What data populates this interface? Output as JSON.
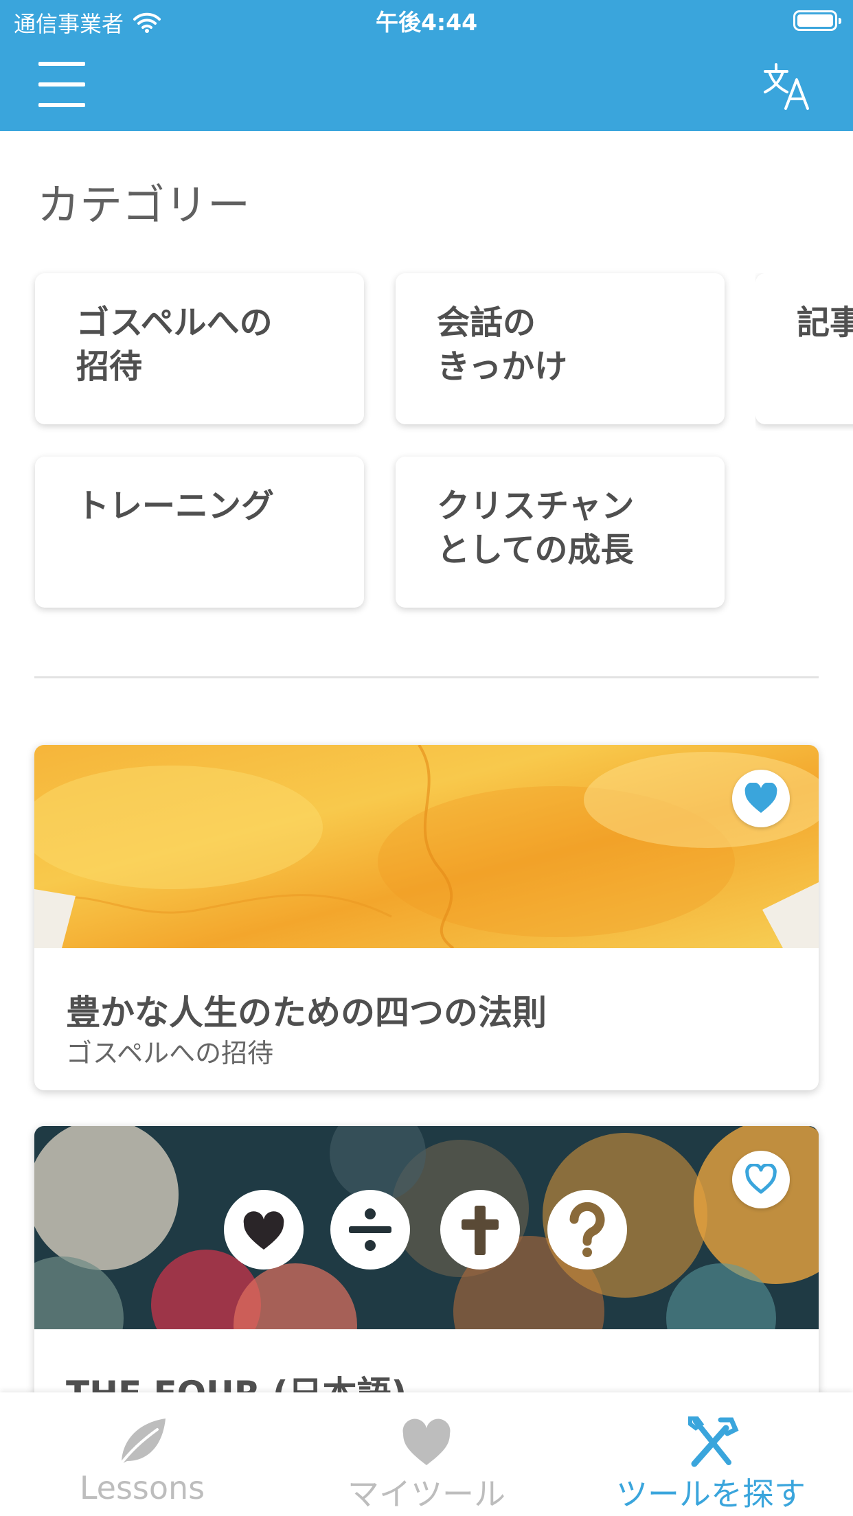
{
  "status_bar": {
    "carrier": "通信事業者",
    "time": "午後4:44",
    "wifi_icon": "wifi-icon",
    "battery_icon": "battery-icon"
  },
  "header": {
    "menu_icon": "hamburger-menu-icon",
    "translate_icon": "translate-icon",
    "color": "#3aa5dc"
  },
  "categories": {
    "title": "カテゴリー",
    "items": [
      {
        "label": "ゴスペルへの\n招待"
      },
      {
        "label": "会話の\nきっかけ"
      },
      {
        "label": "記事"
      },
      {
        "label": "トレーニング"
      },
      {
        "label": "クリスチャン\nとしての成長"
      }
    ]
  },
  "tools": [
    {
      "title": "豊かな人生のための四つの法則",
      "category": "ゴスペルへの招待",
      "favorited": true,
      "favorite_icon": "heart-filled-icon",
      "banner": "yellow-watercolor-image"
    },
    {
      "title": "THE FOUR (日本語)",
      "category": "",
      "favorited": false,
      "favorite_icon": "heart-outline-icon",
      "banner": "bokeh-four-symbols-image",
      "banner_symbols": [
        "heart-icon",
        "divide-icon",
        "cross-icon",
        "question-icon"
      ]
    }
  ],
  "tab_bar": {
    "tabs": [
      {
        "label": "Lessons",
        "icon": "leaf-icon",
        "active": false
      },
      {
        "label": "マイツール",
        "icon": "heart-icon",
        "active": false
      },
      {
        "label": "ツールを探す",
        "icon": "tools-icon",
        "active": true
      }
    ],
    "active_color": "#3aa5dc",
    "inactive_color": "#bdbdbd"
  }
}
